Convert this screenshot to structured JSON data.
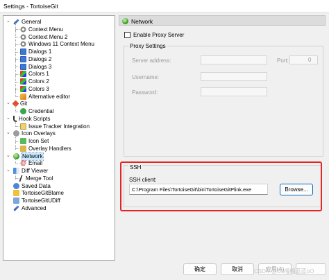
{
  "window": {
    "title": "Settings - TortoiseGit"
  },
  "tree": {
    "items": [
      {
        "label": "General",
        "icon": "wrench-icon",
        "level": 0,
        "expander": "⌄"
      },
      {
        "label": "Context Menu",
        "icon": "gear-icon",
        "level": 1
      },
      {
        "label": "Context Menu 2",
        "icon": "gear-icon",
        "level": 1
      },
      {
        "label": "Windows 11 Context Menu",
        "icon": "gear-icon",
        "level": 1
      },
      {
        "label": "Dialogs 1",
        "icon": "window-icon",
        "level": 1
      },
      {
        "label": "Dialogs 2",
        "icon": "window-icon",
        "level": 1
      },
      {
        "label": "Dialogs 3",
        "icon": "window-icon",
        "level": 1
      },
      {
        "label": "Colors 1",
        "icon": "colors-icon",
        "level": 1
      },
      {
        "label": "Colors 2",
        "icon": "colors-icon",
        "level": 1
      },
      {
        "label": "Colors 3",
        "icon": "colors-icon",
        "level": 1
      },
      {
        "label": "Alternative editor",
        "icon": "editor-icon",
        "level": 1
      },
      {
        "label": "Git",
        "icon": "git-icon",
        "level": 0,
        "expander": "⌄"
      },
      {
        "label": "Credential",
        "icon": "credential-icon",
        "level": 1
      },
      {
        "label": "Hook Scripts",
        "icon": "hook-icon",
        "level": 0,
        "expander": "⌄"
      },
      {
        "label": "Issue Tracker Integration",
        "icon": "issue-tracker-icon",
        "level": 1
      },
      {
        "label": "Icon Overlays",
        "icon": "overlay-icon",
        "level": 0,
        "expander": "⌄"
      },
      {
        "label": "Icon Set",
        "icon": "icon-set-icon",
        "level": 1
      },
      {
        "label": "Overlay Handlers",
        "icon": "overlay-handlers-icon",
        "level": 1
      },
      {
        "label": "Network",
        "icon": "network-icon",
        "level": 0,
        "expander": "⌄",
        "selected": true
      },
      {
        "label": "Email",
        "icon": "email-icon",
        "level": 1
      },
      {
        "label": "Diff Viewer",
        "icon": "diff-icon",
        "level": 0,
        "expander": "⌄"
      },
      {
        "label": "Merge Tool",
        "icon": "merge-icon",
        "level": 1
      },
      {
        "label": "Saved Data",
        "icon": "saved-data-icon",
        "level": 0
      },
      {
        "label": "TortoiseGitBlame",
        "icon": "blame-icon",
        "level": 0
      },
      {
        "label": "TortoiseGitUDiff",
        "icon": "udiff-icon",
        "level": 0
      },
      {
        "label": "Advanced",
        "icon": "wrench-icon",
        "level": 0
      }
    ]
  },
  "page": {
    "title": "Network",
    "enable_proxy_label": "Enable Proxy Server",
    "proxy_settings_title": "Proxy Settings",
    "server_address_label": "Server address:",
    "port_label": "Port:",
    "port_value": "0",
    "username_label": "Username:",
    "password_label": "Password:",
    "ssh_title": "SSH",
    "ssh_client_label": "SSH client:",
    "ssh_client_value": "C:\\Program Files\\TortoiseGit\\bin\\TortoiseGitPlink.exe",
    "browse_label": "Browse..."
  },
  "buttons": {
    "ok_label": "确定",
    "cancel_label": "取消",
    "apply_label": "应用(A)"
  },
  "watermark": "CSDN @Oo嘎嘎蓝蓝oO",
  "colors": {
    "highlight_frame": "#e02626",
    "accent": "#0067c0"
  }
}
